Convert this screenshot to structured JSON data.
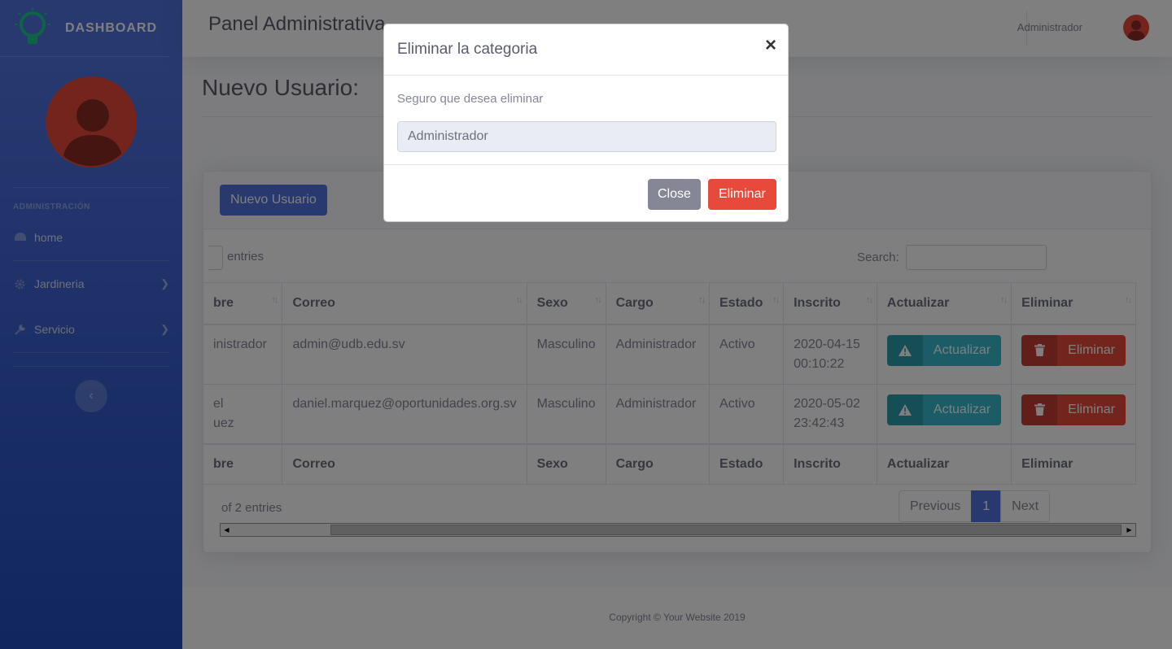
{
  "brand": {
    "title": "DASHBOARD"
  },
  "sidebar": {
    "heading": "ADMINISTRACIÓN",
    "items": [
      {
        "label": "home",
        "icon": "tachometer-icon"
      },
      {
        "label": "Jardineria",
        "icon": "gear-icon"
      },
      {
        "label": "Servicio",
        "icon": "wrench-icon"
      }
    ]
  },
  "topbar": {
    "title": "Panel Administrativa",
    "user": "Administrador"
  },
  "page": {
    "heading": "Nuevo Usuario:",
    "new_button": "Nuevo Usuario"
  },
  "table_controls": {
    "entries_label": "entries",
    "search_label": "Search:"
  },
  "table": {
    "columns": [
      "bre",
      "Correo",
      "Sexo",
      "Cargo",
      "Estado",
      "Inscrito",
      "Actualizar",
      "Eliminar"
    ],
    "rows": [
      {
        "nombre": "inistrador",
        "correo": "admin@udb.edu.sv",
        "sexo": "Masculino",
        "cargo": "Administrador",
        "estado": "Activo",
        "inscrito_fecha": "2020-04-15",
        "inscrito_hora": "00:10:22",
        "actualizar": "Actualizar",
        "eliminar": "Eliminar"
      },
      {
        "nombre": "el",
        "nombre2": "uez",
        "correo": "daniel.marquez@oportunidades.org.sv",
        "sexo": "Masculino",
        "cargo": "Administrador",
        "estado": "Activo",
        "inscrito_fecha": "2020-05-02",
        "inscrito_hora": "23:42:43",
        "actualizar": "Actualizar",
        "eliminar": "Eliminar"
      }
    ]
  },
  "pagination": {
    "info": "of 2 entries",
    "previous": "Previous",
    "current": "1",
    "next": "Next"
  },
  "footer": {
    "text": "Copyright © Your Website 2019"
  },
  "modal": {
    "title": "Eliminar la categoria",
    "close_symbol": "×",
    "question": "Seguro que desea eliminar",
    "field_value": "Administrador",
    "close_button": "Close",
    "confirm_button": "Eliminar"
  },
  "colors": {
    "primary": "#4e73df",
    "danger": "#e74a3b",
    "info": "#36b9cc",
    "secondary": "#858796"
  }
}
